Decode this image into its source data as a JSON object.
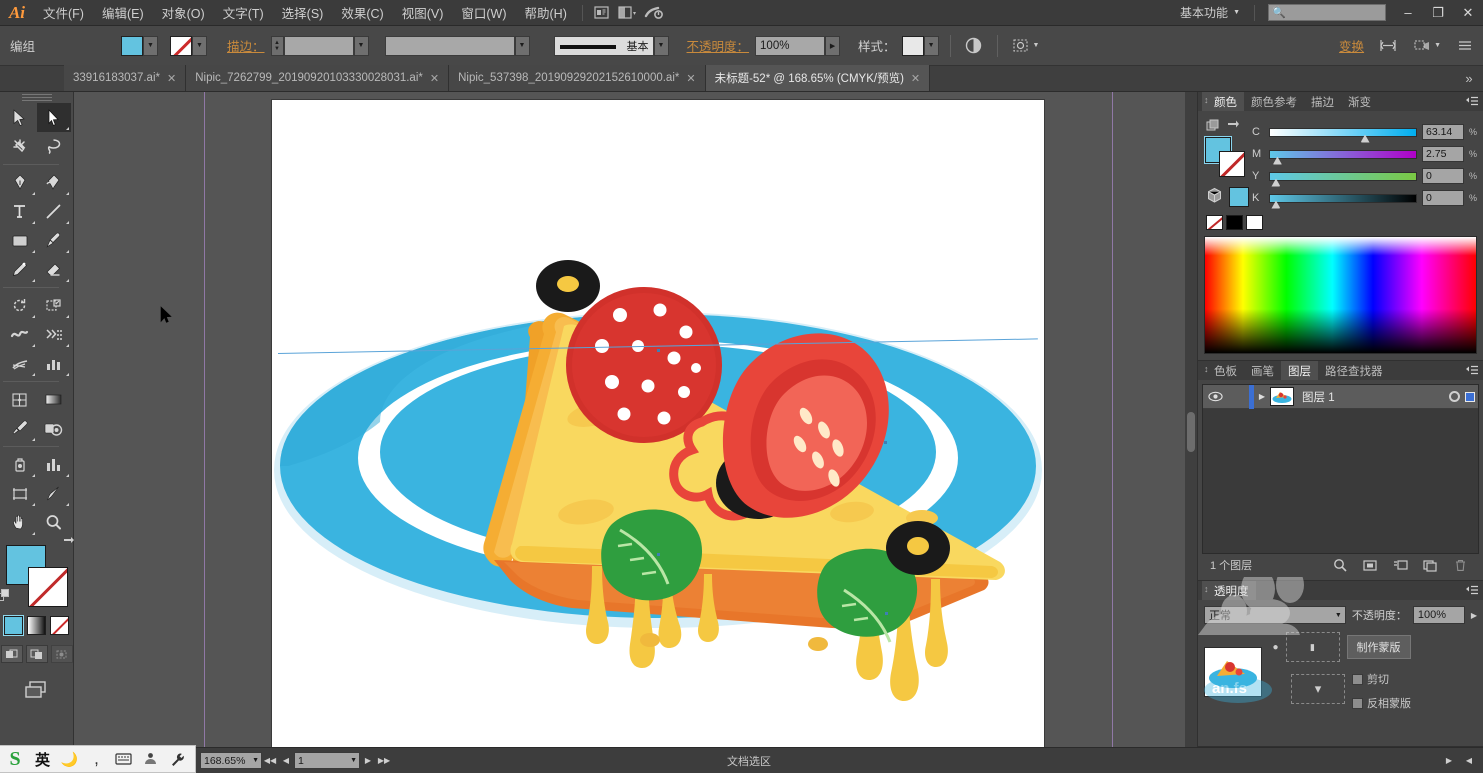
{
  "app": {
    "name": "Adobe Illustrator",
    "logo_text": "Ai"
  },
  "menubar": {
    "items": [
      {
        "label": "文件(F)",
        "name": "menu-file"
      },
      {
        "label": "编辑(E)",
        "name": "menu-edit"
      },
      {
        "label": "对象(O)",
        "name": "menu-object"
      },
      {
        "label": "文字(T)",
        "name": "menu-type"
      },
      {
        "label": "选择(S)",
        "name": "menu-select"
      },
      {
        "label": "效果(C)",
        "name": "menu-effect"
      },
      {
        "label": "视图(V)",
        "name": "menu-view"
      },
      {
        "label": "窗口(W)",
        "name": "menu-window"
      },
      {
        "label": "帮助(H)",
        "name": "menu-help"
      }
    ],
    "workspace": "基本功能",
    "search_placeholder": "",
    "window_buttons": {
      "minimize": "–",
      "restore": "❐",
      "close": "✕"
    }
  },
  "controlbar": {
    "selection_label": "编组",
    "fill_color": "#63c3e0",
    "stroke_color": "none",
    "stroke_label": "描边：",
    "stroke_weight": "",
    "stroke_style": "",
    "stroke_profile_label": "基本",
    "opacity_label": "不透明度：",
    "opacity_value": "100%",
    "style_label": "样式：",
    "transform_label": "变换",
    "align_label": "",
    "transform_icon": "transform-icon"
  },
  "tabs": {
    "items": [
      {
        "title": "33916183037.ai*",
        "active": false
      },
      {
        "title": "Nipic_7262799_20190920103330028031.ai*",
        "active": false
      },
      {
        "title": "Nipic_537398_20190929202152610000.ai*",
        "active": false
      },
      {
        "title": "未标题-52* @ 168.65% (CMYK/预览)",
        "active": true
      }
    ],
    "overflow_label": "»",
    "close_glyph": "✕"
  },
  "toolbar": {
    "tools": [
      {
        "name": "selection-tool",
        "label": "选择工具",
        "active": false
      },
      {
        "name": "direct-selection-tool",
        "label": "直接选择工具",
        "active": true
      },
      {
        "name": "magic-wand-tool",
        "label": "魔棒工具",
        "active": false
      },
      {
        "name": "lasso-tool",
        "label": "套索工具",
        "active": false
      },
      {
        "name": "pen-tool",
        "label": "钢笔工具",
        "active": false
      },
      {
        "name": "curvature-tool",
        "label": "曲率工具",
        "active": false
      },
      {
        "name": "type-tool",
        "label": "文字工具",
        "active": false
      },
      {
        "name": "line-segment-tool",
        "label": "直线段工具",
        "active": false
      },
      {
        "name": "rectangle-tool",
        "label": "矩形工具",
        "active": false
      },
      {
        "name": "paintbrush-tool",
        "label": "画笔工具",
        "active": false
      },
      {
        "name": "pencil-tool",
        "label": "铅笔工具",
        "active": false
      },
      {
        "name": "eraser-tool",
        "label": "橡皮擦工具",
        "active": false
      },
      {
        "name": "rotate-tool",
        "label": "旋转工具",
        "active": false
      },
      {
        "name": "scale-tool",
        "label": "比例缩放工具",
        "active": false
      },
      {
        "name": "width-tool",
        "label": "宽度工具",
        "active": false
      },
      {
        "name": "shape-builder-tool",
        "label": "形状生成器工具",
        "active": false
      },
      {
        "name": "perspective-grid-tool",
        "label": "透视网格工具",
        "active": false
      },
      {
        "name": "graph-tool",
        "label": "图表工具",
        "active": false
      },
      {
        "name": "mesh-tool",
        "label": "网格工具",
        "active": false
      },
      {
        "name": "gradient-tool",
        "label": "渐变工具",
        "active": false
      },
      {
        "name": "eyedropper-tool",
        "label": "吸管工具",
        "active": false
      },
      {
        "name": "blend-tool",
        "label": "混合工具",
        "active": false
      },
      {
        "name": "symbol-sprayer-tool",
        "label": "符号喷枪工具",
        "active": false
      },
      {
        "name": "column-graph-tool",
        "label": "柱形图工具",
        "active": false
      },
      {
        "name": "artboard-tool",
        "label": "画板工具",
        "active": false
      },
      {
        "name": "slice-tool",
        "label": "切片工具",
        "active": false
      },
      {
        "name": "hand-tool",
        "label": "抓手工具",
        "active": false
      },
      {
        "name": "zoom-tool",
        "label": "缩放工具",
        "active": false
      }
    ],
    "fill_color": "#63c3e0",
    "stroke_color": "none",
    "paint_modes": [
      "color-fill",
      "gradient-fill",
      "none-fill"
    ],
    "draw_modes": [
      "draw-normal",
      "draw-behind",
      "draw-inside"
    ],
    "screen_mode": "change-screen-mode"
  },
  "canvas": {
    "artwork_title": "披萨插画",
    "artwork_description": "蓝色盘子上的披萨切片插画"
  },
  "panels": {
    "color": {
      "tabs": [
        {
          "label": "颜色",
          "active": true
        },
        {
          "label": "颜色参考",
          "active": false
        },
        {
          "label": "描边",
          "active": false
        },
        {
          "label": "渐变",
          "active": false
        }
      ],
      "mode": "CMYK",
      "channels": [
        {
          "label": "C",
          "value": "63.14",
          "unit": "%",
          "pos": 63
        },
        {
          "label": "M",
          "value": "2.75",
          "unit": "%",
          "pos": 3
        },
        {
          "label": "Y",
          "value": "0",
          "unit": "%",
          "pos": 0
        },
        {
          "label": "K",
          "value": "0",
          "unit": "%",
          "pos": 0
        }
      ],
      "fill_color": "#63c3e0",
      "quick_swatches": [
        "none",
        "#000000",
        "#ffffff"
      ]
    },
    "layers": {
      "tabs": [
        {
          "label": "色板",
          "active": false
        },
        {
          "label": "画笔",
          "active": false
        },
        {
          "label": "图层",
          "active": true
        },
        {
          "label": "路径查找器",
          "active": false
        }
      ],
      "rows": [
        {
          "name": "图层 1",
          "visible": true,
          "locked": false,
          "selected": true,
          "color": "#3b6fd4"
        }
      ],
      "count_label": "1 个图层",
      "footer_icons": [
        "locate-object-icon",
        "make-clipping-mask-icon",
        "create-new-sublayer-icon",
        "create-new-layer-icon",
        "delete-selection-icon"
      ]
    },
    "transparency": {
      "title": "透明度",
      "blend_mode": "正常",
      "opacity_label": "不透明度：",
      "opacity_value": "100%",
      "make_mask_label": "制作蒙版",
      "clip_label": "剪切",
      "invert_mask_label": "反相蒙版"
    }
  },
  "statusbar": {
    "zoom_value": "168.65%",
    "artboard_nav": "1",
    "status_text": "文档选区",
    "prev_glyph": "◀",
    "next_glyph": "▶"
  },
  "ime": {
    "logo": "S",
    "mode": "英",
    "items": [
      "moon-icon",
      "comma-icon",
      "keyboard-icon",
      "toolbox-icon",
      "wrench-icon"
    ]
  },
  "colors": {
    "accent_fill": "#63c3e0",
    "plate_blue": "#3ab4e0",
    "plate_blue_dark": "#2aa3d4",
    "crust_orange": "#f0a128",
    "crust_dark": "#e08a18",
    "cheese_yellow": "#f9d85f",
    "cheese_drip": "#f5c842",
    "salami_red": "#d8352f",
    "tomato_red": "#e8453a",
    "olive_black": "#1a1a1a",
    "basil_green": "#2f9e3f",
    "sauce_orange": "#e8762a",
    "ui_bg": "#484848",
    "ui_panel": "#454545",
    "ui_menubar": "#3b3b3b"
  }
}
